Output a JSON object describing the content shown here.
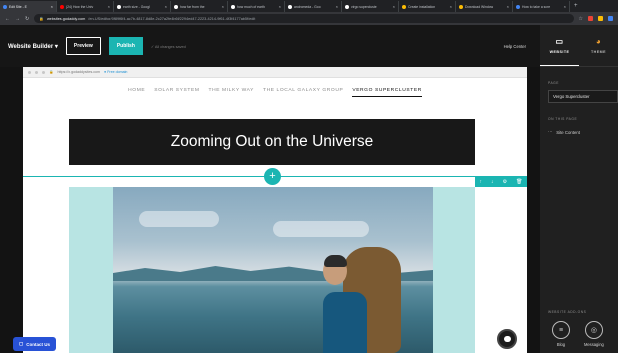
{
  "browser": {
    "tabs": [
      {
        "label": "Edit Site - E",
        "color": "#4285f4",
        "active": true
      },
      {
        "label": "(24) How the Univ",
        "color": "#ff0000",
        "active": false
      },
      {
        "label": "earth size - Googl",
        "color": "#ffffff",
        "active": false
      },
      {
        "label": "how far from the",
        "color": "#ffffff",
        "active": false
      },
      {
        "label": "how much of earth",
        "color": "#ffffff",
        "active": false
      },
      {
        "label": "andromeda - Goo",
        "color": "#ffffff",
        "active": false
      },
      {
        "label": "virgo supercluste",
        "color": "#ffffff",
        "active": false
      },
      {
        "label": "Create installation",
        "color": "#fbbc04",
        "active": false
      },
      {
        "label": "Download Window",
        "color": "#fbbc04",
        "active": false
      },
      {
        "label": "How to take a scre",
        "color": "#4285f4",
        "active": false
      }
    ],
    "new_tab": "+",
    "url_host": "websites.godaddy.com",
    "url_path": "/en-US/editor/0f89f6f4-ac7b-4817-8d8e-2c27a2fe4b6f/2294ed47-2223-4214-9f61-4f3f4177ab5f/edit"
  },
  "builder": {
    "brand": "Website Builder",
    "brand_caret": "▾",
    "preview": "Preview",
    "publish": "Publish",
    "saved": "✓ All changes saved",
    "help": "Help Center"
  },
  "site": {
    "address": "https://x.godaddysites.com",
    "free_domain": "Free domain",
    "nav": [
      "HOME",
      "SOLAR SYSTEM",
      "THE MILKY WAY",
      "THE LOCAL GALAXY GROUP",
      "VERGO SUPERCLUSTER"
    ],
    "hero_title": "Zooming Out on the Universe",
    "add_section": "+",
    "contact": "Contact Us"
  },
  "panel": {
    "tab_website": "WEBSITE",
    "tab_theme": "THEME",
    "page_label": "PAGE",
    "page_value": "Vergo Supercluster",
    "on_page_label": "ON THIS PAGE",
    "on_page_item": "Site Content",
    "addons_label": "WEBSITE ADD-ONS",
    "addon_blog": "Blog",
    "addon_messaging": "Messaging"
  },
  "colors": {
    "accent": "#1bb5b2",
    "contact": "#2852d6",
    "dark": "#161616"
  }
}
